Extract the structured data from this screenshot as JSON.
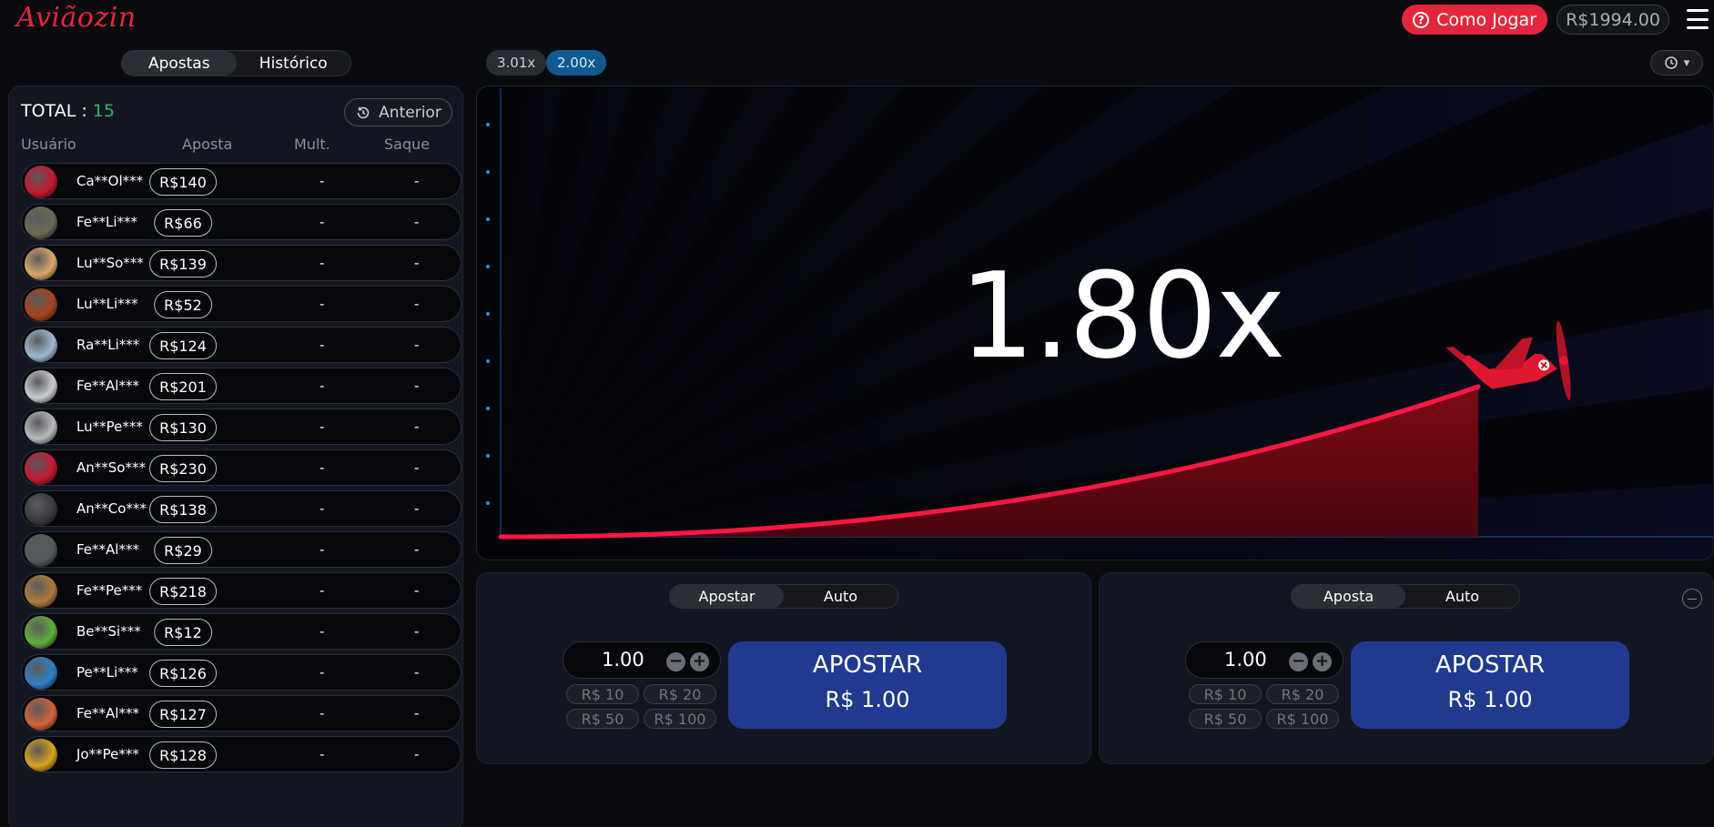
{
  "header": {
    "logo": "Aviãozin",
    "como_jogar": "Como Jogar",
    "balance": "R$1994.00"
  },
  "left_tabs": [
    "Apostas",
    "Histórico"
  ],
  "history_chips": [
    "3.01x",
    "2.00x"
  ],
  "bets": {
    "total_label": "TOTAL :",
    "total_value": "15",
    "anterior_label": "Anterior",
    "columns": [
      "Usuário",
      "Aposta",
      "Mult.",
      "Saque"
    ],
    "rows": [
      {
        "user": "Ca**Ol***",
        "amount": "R$140",
        "mult": "-",
        "saque": "-",
        "avatar": "#c41830"
      },
      {
        "user": "Fe**Li***",
        "amount": "R$66",
        "mult": "-",
        "saque": "-",
        "avatar": "#6b6a55"
      },
      {
        "user": "Lu**So***",
        "amount": "R$139",
        "mult": "-",
        "saque": "-",
        "avatar": "#d9a86a"
      },
      {
        "user": "Lu**Li***",
        "amount": "R$52",
        "mult": "-",
        "saque": "-",
        "avatar": "#a8421d"
      },
      {
        "user": "Ra**Li***",
        "amount": "R$124",
        "mult": "-",
        "saque": "-",
        "avatar": "#9fb8d2"
      },
      {
        "user": "Fe**Al***",
        "amount": "R$201",
        "mult": "-",
        "saque": "-",
        "avatar": "#c9ccd2"
      },
      {
        "user": "Lu**Pe***",
        "amount": "R$130",
        "mult": "-",
        "saque": "-",
        "avatar": "#b6b9be"
      },
      {
        "user": "An**So***",
        "amount": "R$230",
        "mult": "-",
        "saque": "-",
        "avatar": "#c41830"
      },
      {
        "user": "An**Co***",
        "amount": "R$138",
        "mult": "-",
        "saque": "-",
        "avatar": "#3a3c42"
      },
      {
        "user": "Fe**Al***",
        "amount": "R$29",
        "mult": "-",
        "saque": "-",
        "avatar": "#55585e"
      },
      {
        "user": "Fe**Pe***",
        "amount": "R$218",
        "mult": "-",
        "saque": "-",
        "avatar": "#b07a3c"
      },
      {
        "user": "Be**Si***",
        "amount": "R$12",
        "mult": "-",
        "saque": "-",
        "avatar": "#5fae3c"
      },
      {
        "user": "Pe**Li***",
        "amount": "R$126",
        "mult": "-",
        "saque": "-",
        "avatar": "#2f7fc8"
      },
      {
        "user": "Fe**Al***",
        "amount": "R$127",
        "mult": "-",
        "saque": "-",
        "avatar": "#d3613a"
      },
      {
        "user": "Jo**Pe***",
        "amount": "R$128",
        "mult": "-",
        "saque": "-",
        "avatar": "#d8a21c"
      }
    ]
  },
  "game": {
    "multiplier": "1.80x",
    "progress": 0.8
  },
  "panels": [
    {
      "tabs": [
        "Apostar",
        "Auto"
      ],
      "stake": "1.00",
      "quick": [
        "R$ 10",
        "R$ 20",
        "R$ 50",
        "R$ 100"
      ],
      "button_l1": "APOSTAR",
      "button_l2": "R$ 1.00"
    },
    {
      "tabs": [
        "Aposta",
        "Auto"
      ],
      "stake": "1.00",
      "quick": [
        "R$ 10",
        "R$ 20",
        "R$ 50",
        "R$ 100"
      ],
      "button_l1": "APOSTAR",
      "button_l2": "R$ 1.00"
    }
  ],
  "colors": {
    "accent_red": "#e3263e",
    "bet_button": "#1f3a8f",
    "total_green": "#2cb36a"
  }
}
